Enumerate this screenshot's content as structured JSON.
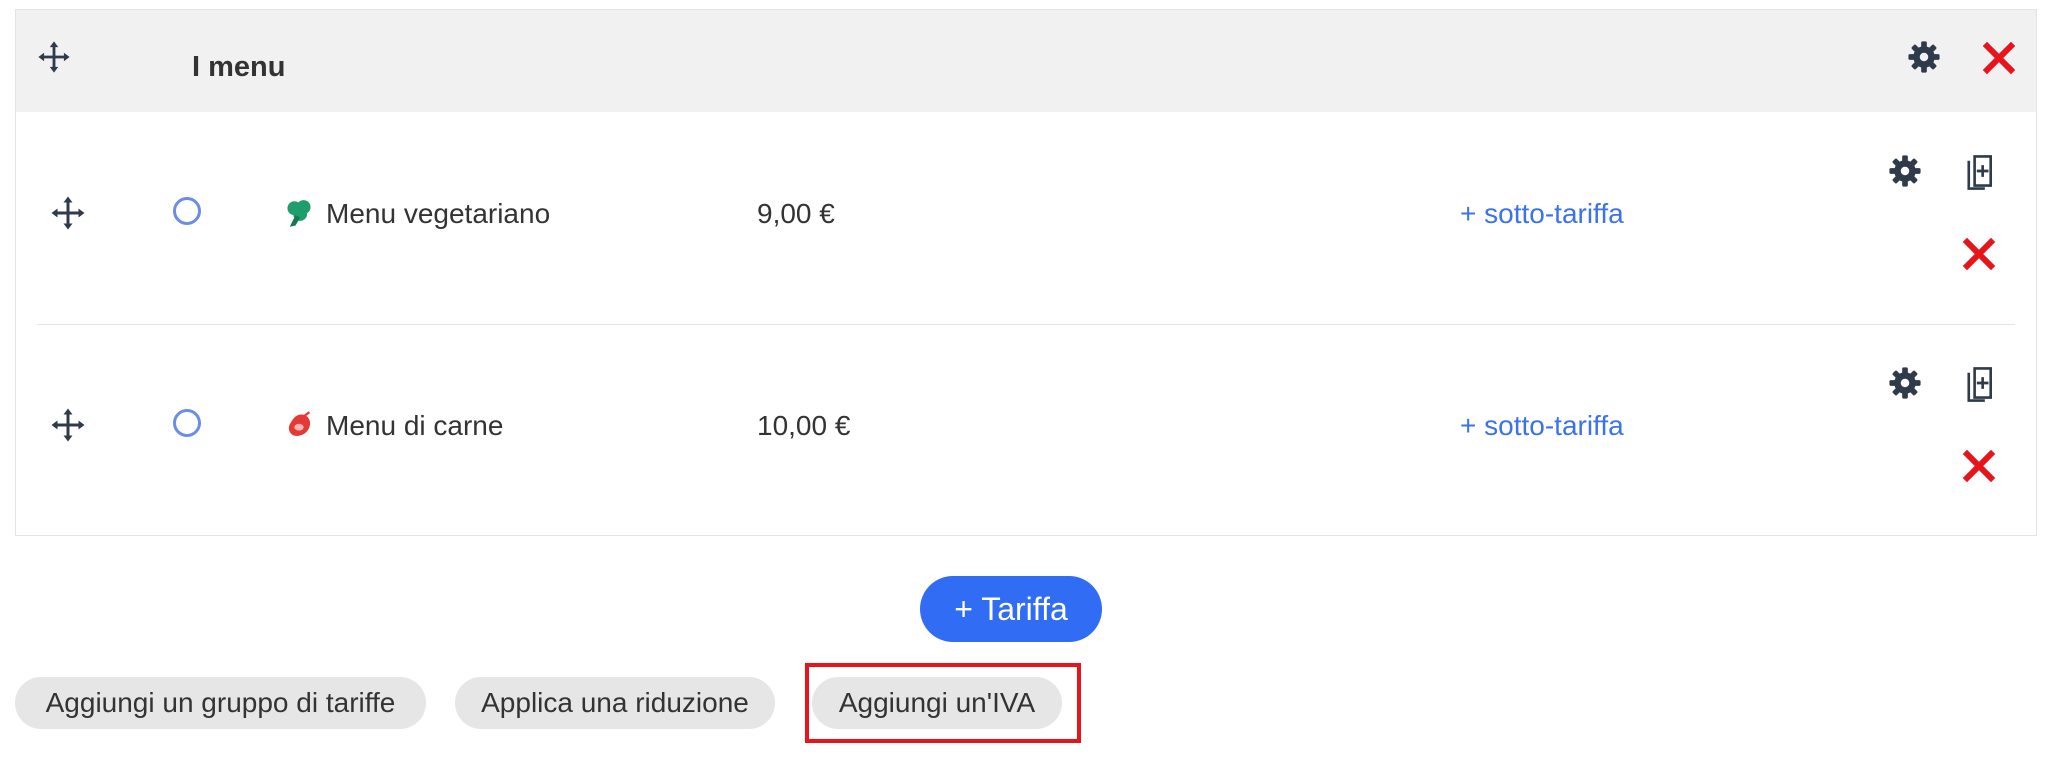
{
  "group": {
    "title": "I menu",
    "icons": {
      "move": "move-arrows-icon",
      "settings": "gear-icon",
      "delete": "close-icon"
    }
  },
  "items": [
    {
      "name": "Menu vegetariano",
      "price": "9,00 €",
      "sub_link": "+ sotto-tariffa",
      "category_icon": "broccoli-icon",
      "category_color": "#1e9e6a"
    },
    {
      "name": "Menu di carne",
      "price": "10,00 €",
      "sub_link": "+ sotto-tariffa",
      "category_icon": "meat-icon",
      "category_color": "#e53935"
    }
  ],
  "actions": {
    "add_rate": "+ Tariffa",
    "add_rate_group": "Aggiungi un gruppo di tariffe",
    "apply_discount": "Applica una riduzione",
    "add_vat": "Aggiungi un'IVA"
  },
  "colors": {
    "primary": "#316cf4",
    "link": "#3b73ea",
    "danger": "#e8141b",
    "icon_dark": "#2f3b4a",
    "header_bg": "#f1f1f1"
  }
}
